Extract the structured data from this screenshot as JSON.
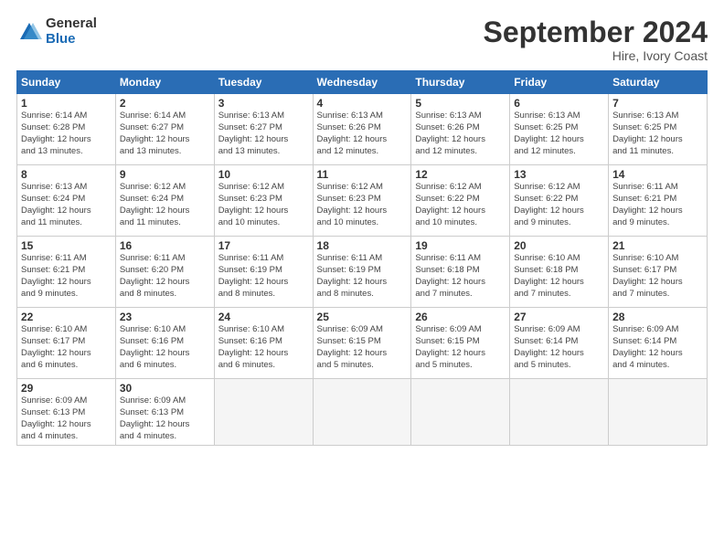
{
  "logo": {
    "general": "General",
    "blue": "Blue"
  },
  "title": "September 2024",
  "location": "Hire, Ivory Coast",
  "days_of_week": [
    "Sunday",
    "Monday",
    "Tuesday",
    "Wednesday",
    "Thursday",
    "Friday",
    "Saturday"
  ],
  "weeks": [
    [
      {
        "day": "1",
        "info": "Sunrise: 6:14 AM\nSunset: 6:28 PM\nDaylight: 12 hours\nand 13 minutes."
      },
      {
        "day": "2",
        "info": "Sunrise: 6:14 AM\nSunset: 6:27 PM\nDaylight: 12 hours\nand 13 minutes."
      },
      {
        "day": "3",
        "info": "Sunrise: 6:13 AM\nSunset: 6:27 PM\nDaylight: 12 hours\nand 13 minutes."
      },
      {
        "day": "4",
        "info": "Sunrise: 6:13 AM\nSunset: 6:26 PM\nDaylight: 12 hours\nand 12 minutes."
      },
      {
        "day": "5",
        "info": "Sunrise: 6:13 AM\nSunset: 6:26 PM\nDaylight: 12 hours\nand 12 minutes."
      },
      {
        "day": "6",
        "info": "Sunrise: 6:13 AM\nSunset: 6:25 PM\nDaylight: 12 hours\nand 12 minutes."
      },
      {
        "day": "7",
        "info": "Sunrise: 6:13 AM\nSunset: 6:25 PM\nDaylight: 12 hours\nand 11 minutes."
      }
    ],
    [
      {
        "day": "8",
        "info": "Sunrise: 6:13 AM\nSunset: 6:24 PM\nDaylight: 12 hours\nand 11 minutes."
      },
      {
        "day": "9",
        "info": "Sunrise: 6:12 AM\nSunset: 6:24 PM\nDaylight: 12 hours\nand 11 minutes."
      },
      {
        "day": "10",
        "info": "Sunrise: 6:12 AM\nSunset: 6:23 PM\nDaylight: 12 hours\nand 10 minutes."
      },
      {
        "day": "11",
        "info": "Sunrise: 6:12 AM\nSunset: 6:23 PM\nDaylight: 12 hours\nand 10 minutes."
      },
      {
        "day": "12",
        "info": "Sunrise: 6:12 AM\nSunset: 6:22 PM\nDaylight: 12 hours\nand 10 minutes."
      },
      {
        "day": "13",
        "info": "Sunrise: 6:12 AM\nSunset: 6:22 PM\nDaylight: 12 hours\nand 9 minutes."
      },
      {
        "day": "14",
        "info": "Sunrise: 6:11 AM\nSunset: 6:21 PM\nDaylight: 12 hours\nand 9 minutes."
      }
    ],
    [
      {
        "day": "15",
        "info": "Sunrise: 6:11 AM\nSunset: 6:21 PM\nDaylight: 12 hours\nand 9 minutes."
      },
      {
        "day": "16",
        "info": "Sunrise: 6:11 AM\nSunset: 6:20 PM\nDaylight: 12 hours\nand 8 minutes."
      },
      {
        "day": "17",
        "info": "Sunrise: 6:11 AM\nSunset: 6:19 PM\nDaylight: 12 hours\nand 8 minutes."
      },
      {
        "day": "18",
        "info": "Sunrise: 6:11 AM\nSunset: 6:19 PM\nDaylight: 12 hours\nand 8 minutes."
      },
      {
        "day": "19",
        "info": "Sunrise: 6:11 AM\nSunset: 6:18 PM\nDaylight: 12 hours\nand 7 minutes."
      },
      {
        "day": "20",
        "info": "Sunrise: 6:10 AM\nSunset: 6:18 PM\nDaylight: 12 hours\nand 7 minutes."
      },
      {
        "day": "21",
        "info": "Sunrise: 6:10 AM\nSunset: 6:17 PM\nDaylight: 12 hours\nand 7 minutes."
      }
    ],
    [
      {
        "day": "22",
        "info": "Sunrise: 6:10 AM\nSunset: 6:17 PM\nDaylight: 12 hours\nand 6 minutes."
      },
      {
        "day": "23",
        "info": "Sunrise: 6:10 AM\nSunset: 6:16 PM\nDaylight: 12 hours\nand 6 minutes."
      },
      {
        "day": "24",
        "info": "Sunrise: 6:10 AM\nSunset: 6:16 PM\nDaylight: 12 hours\nand 6 minutes."
      },
      {
        "day": "25",
        "info": "Sunrise: 6:09 AM\nSunset: 6:15 PM\nDaylight: 12 hours\nand 5 minutes."
      },
      {
        "day": "26",
        "info": "Sunrise: 6:09 AM\nSunset: 6:15 PM\nDaylight: 12 hours\nand 5 minutes."
      },
      {
        "day": "27",
        "info": "Sunrise: 6:09 AM\nSunset: 6:14 PM\nDaylight: 12 hours\nand 5 minutes."
      },
      {
        "day": "28",
        "info": "Sunrise: 6:09 AM\nSunset: 6:14 PM\nDaylight: 12 hours\nand 4 minutes."
      }
    ],
    [
      {
        "day": "29",
        "info": "Sunrise: 6:09 AM\nSunset: 6:13 PM\nDaylight: 12 hours\nand 4 minutes."
      },
      {
        "day": "30",
        "info": "Sunrise: 6:09 AM\nSunset: 6:13 PM\nDaylight: 12 hours\nand 4 minutes."
      },
      {
        "day": "",
        "info": ""
      },
      {
        "day": "",
        "info": ""
      },
      {
        "day": "",
        "info": ""
      },
      {
        "day": "",
        "info": ""
      },
      {
        "day": "",
        "info": ""
      }
    ]
  ]
}
